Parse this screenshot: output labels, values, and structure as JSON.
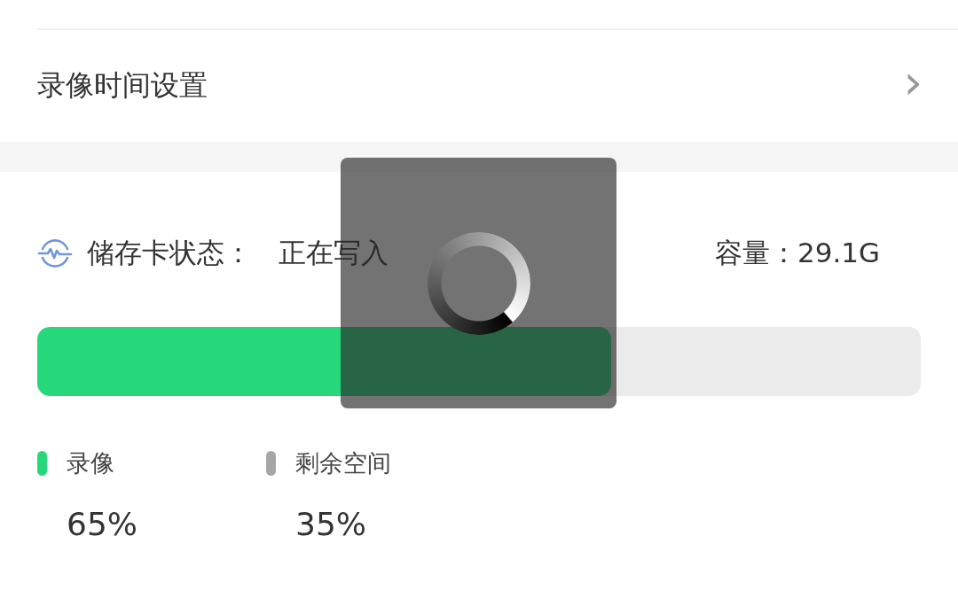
{
  "settings_row": {
    "label": "录像时间设置",
    "chevron": "›"
  },
  "storage": {
    "label": "储存卡状态：",
    "status": "正在写入",
    "capacity": "容量：29.1G",
    "level": 0.65
  },
  "legend": [
    {
      "label": "录像",
      "color": "#26d87a",
      "percent": "65%"
    },
    {
      "label": "剩余空间",
      "color": "#a6a6a6",
      "percent": "35%"
    }
  ],
  "loading": {
    "visible": true
  }
}
